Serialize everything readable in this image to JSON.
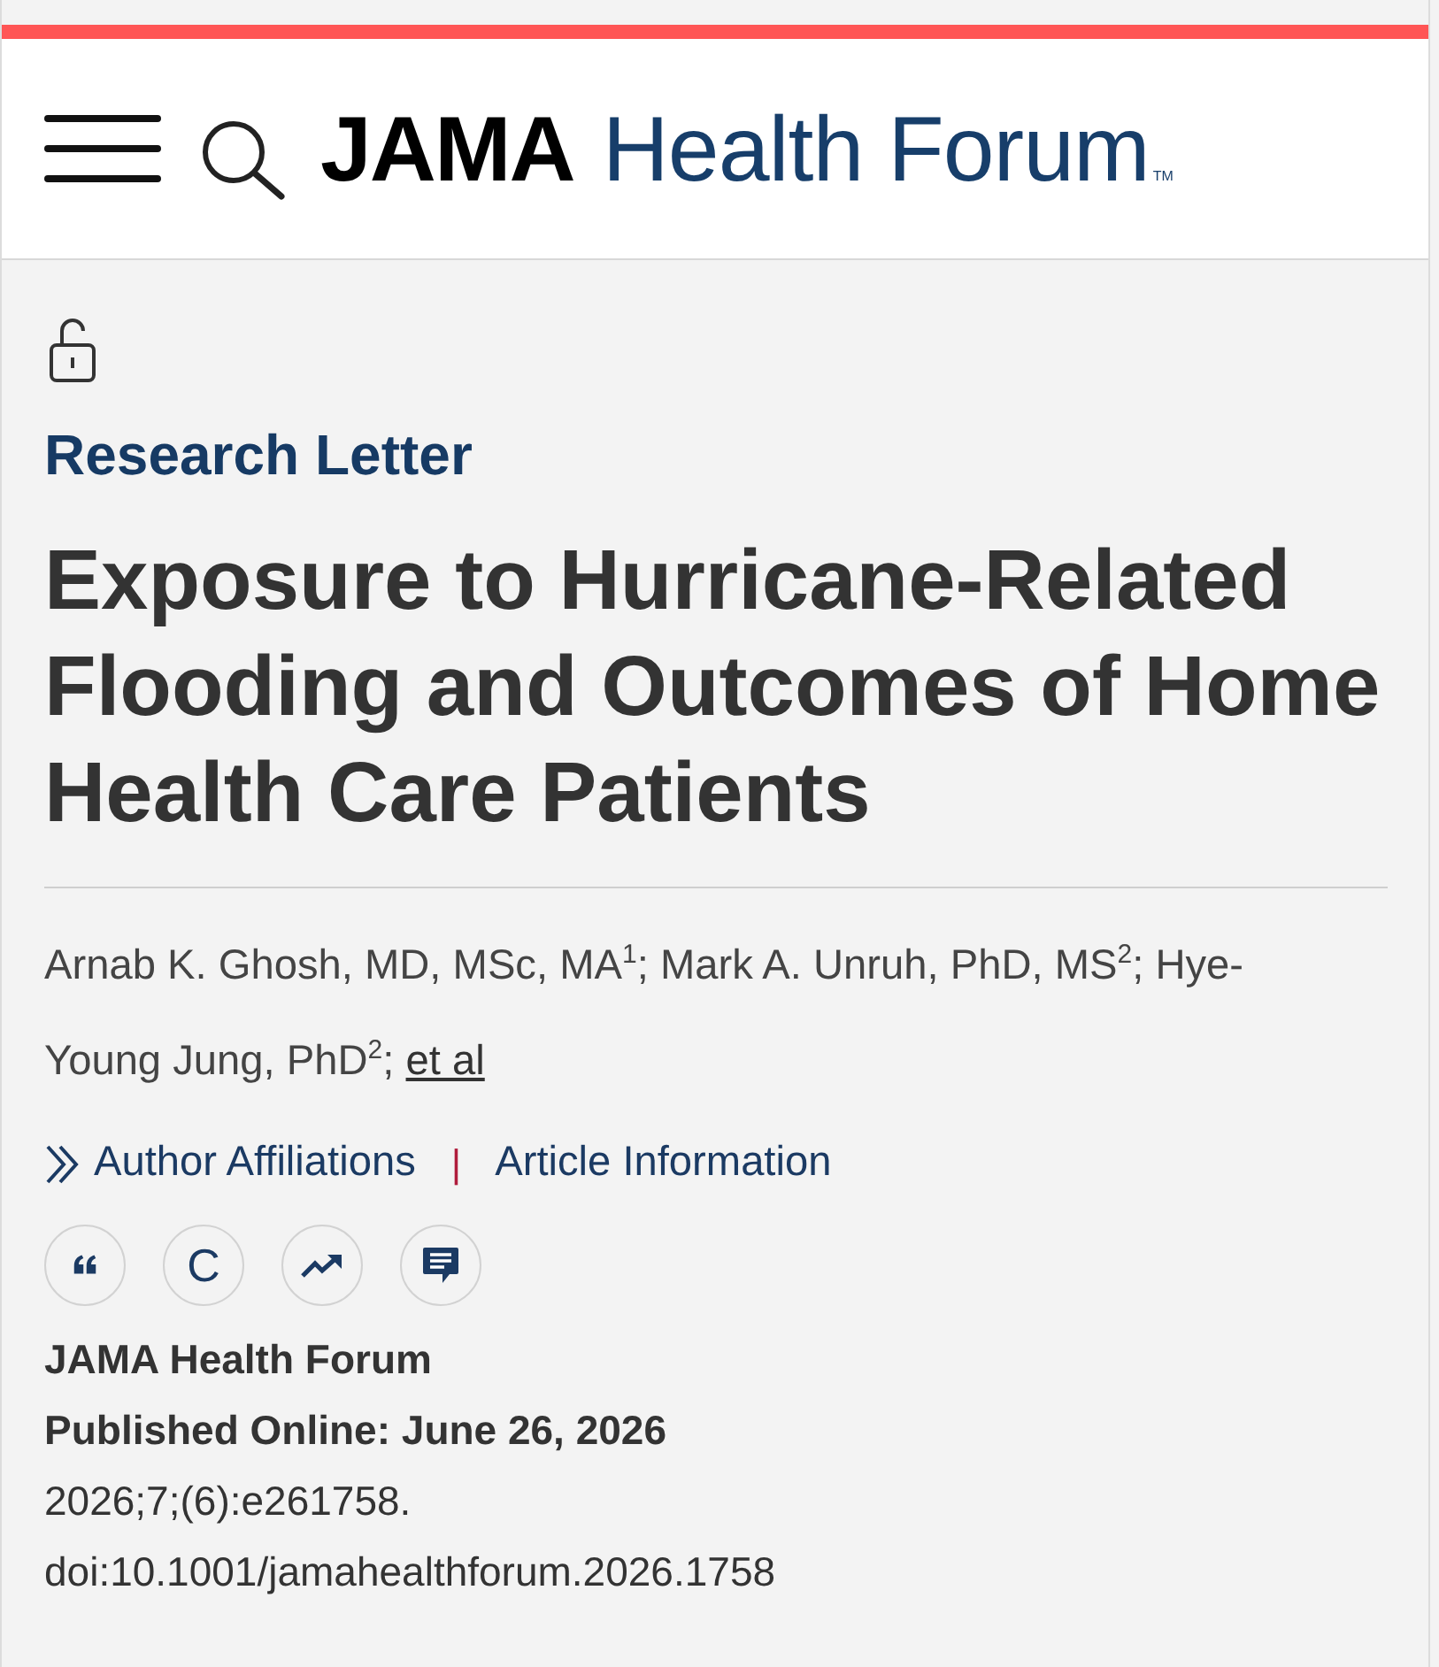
{
  "header": {
    "logo": {
      "brand": "JAMA",
      "journal": "Health Forum",
      "trademark": "TM"
    }
  },
  "article": {
    "article_type": "Research Letter",
    "title": "Exposure to Hurricane-Related Flooding and Outcomes of Home Health Care Patients",
    "authors": {
      "text": "Arnab K. Ghosh, MD, MSc, MA$^{1}$; Mark A. Unruh, PhD, MS$^{2}$; Hye-Young Jung, PhD$^{2}$;",
      "more_link": "et al"
    },
    "links": [
      {
        "kind": "expand",
        "label": "Author Affiliations"
      },
      {
        "kind": "plain",
        "label": "Article Information"
      }
    ],
    "link_separator": "|",
    "actions": [
      {
        "kind": "quote"
      },
      {
        "kind": "letter",
        "label": "C"
      },
      {
        "kind": "metrics"
      },
      {
        "kind": "comments"
      }
    ],
    "journal": "JAMA Health Forum",
    "published": "Published Online: June 26, 2026",
    "citation": "2026;7;(6):e261758.",
    "doi": "doi:10.1001/jamahealthforum.2026.1758"
  }
}
